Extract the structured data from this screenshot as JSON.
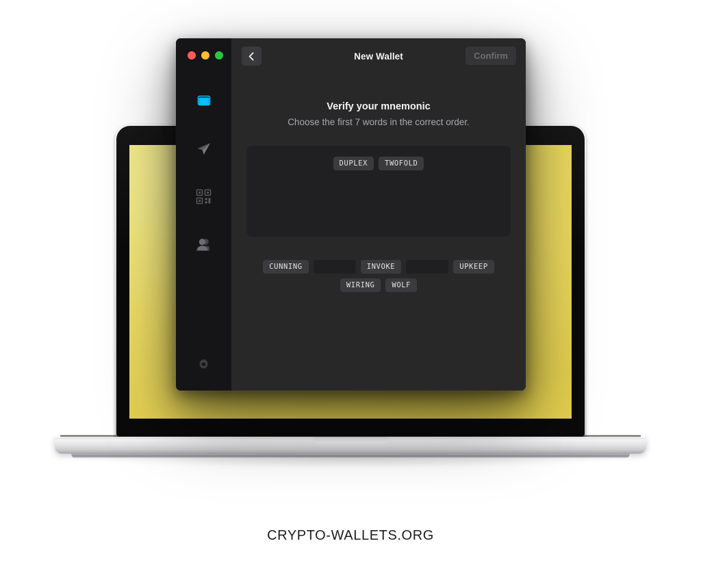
{
  "brand": {
    "text": "CRYPTO-WALLETS.ORG"
  },
  "device": {
    "type": "laptop",
    "screen_color": "#EDDC64"
  },
  "window": {
    "title": "New Wallet",
    "traffic_lights": [
      {
        "name": "close",
        "color": "#FF5F57"
      },
      {
        "name": "minimize",
        "color": "#FFBD2E"
      },
      {
        "name": "zoom",
        "color": "#28C840"
      }
    ],
    "back_button": {
      "icon": "chevron-left-icon",
      "label": ""
    },
    "confirm_button": {
      "label": "Confirm",
      "enabled": false
    }
  },
  "sidebar": {
    "background": "#151416",
    "active_color": "#00BFFF",
    "items": [
      {
        "icon": "wallet-icon",
        "name": "wallet",
        "active": true
      },
      {
        "icon": "send-icon",
        "name": "send",
        "active": false
      },
      {
        "icon": "qr-code-icon",
        "name": "receive",
        "active": false
      },
      {
        "icon": "contacts-icon",
        "name": "contacts",
        "active": false
      }
    ],
    "bottom": [
      {
        "icon": "gear-icon",
        "name": "settings",
        "active": false
      }
    ]
  },
  "main": {
    "heading": "Verify your mnemonic",
    "subheading": "Choose the first 7 words in the correct order.",
    "selected_words": [
      "DUPLEX",
      "TWOFOLD"
    ],
    "word_bank_rows": [
      [
        {
          "label": "CUNNING",
          "used": false
        },
        {
          "label": "",
          "used": true
        },
        {
          "label": "INVOKE",
          "used": false
        },
        {
          "label": "",
          "used": true
        },
        {
          "label": "UPKEEP",
          "used": false
        }
      ],
      [
        {
          "label": "WIRING",
          "used": false
        },
        {
          "label": "WOLF",
          "used": false
        }
      ]
    ]
  }
}
